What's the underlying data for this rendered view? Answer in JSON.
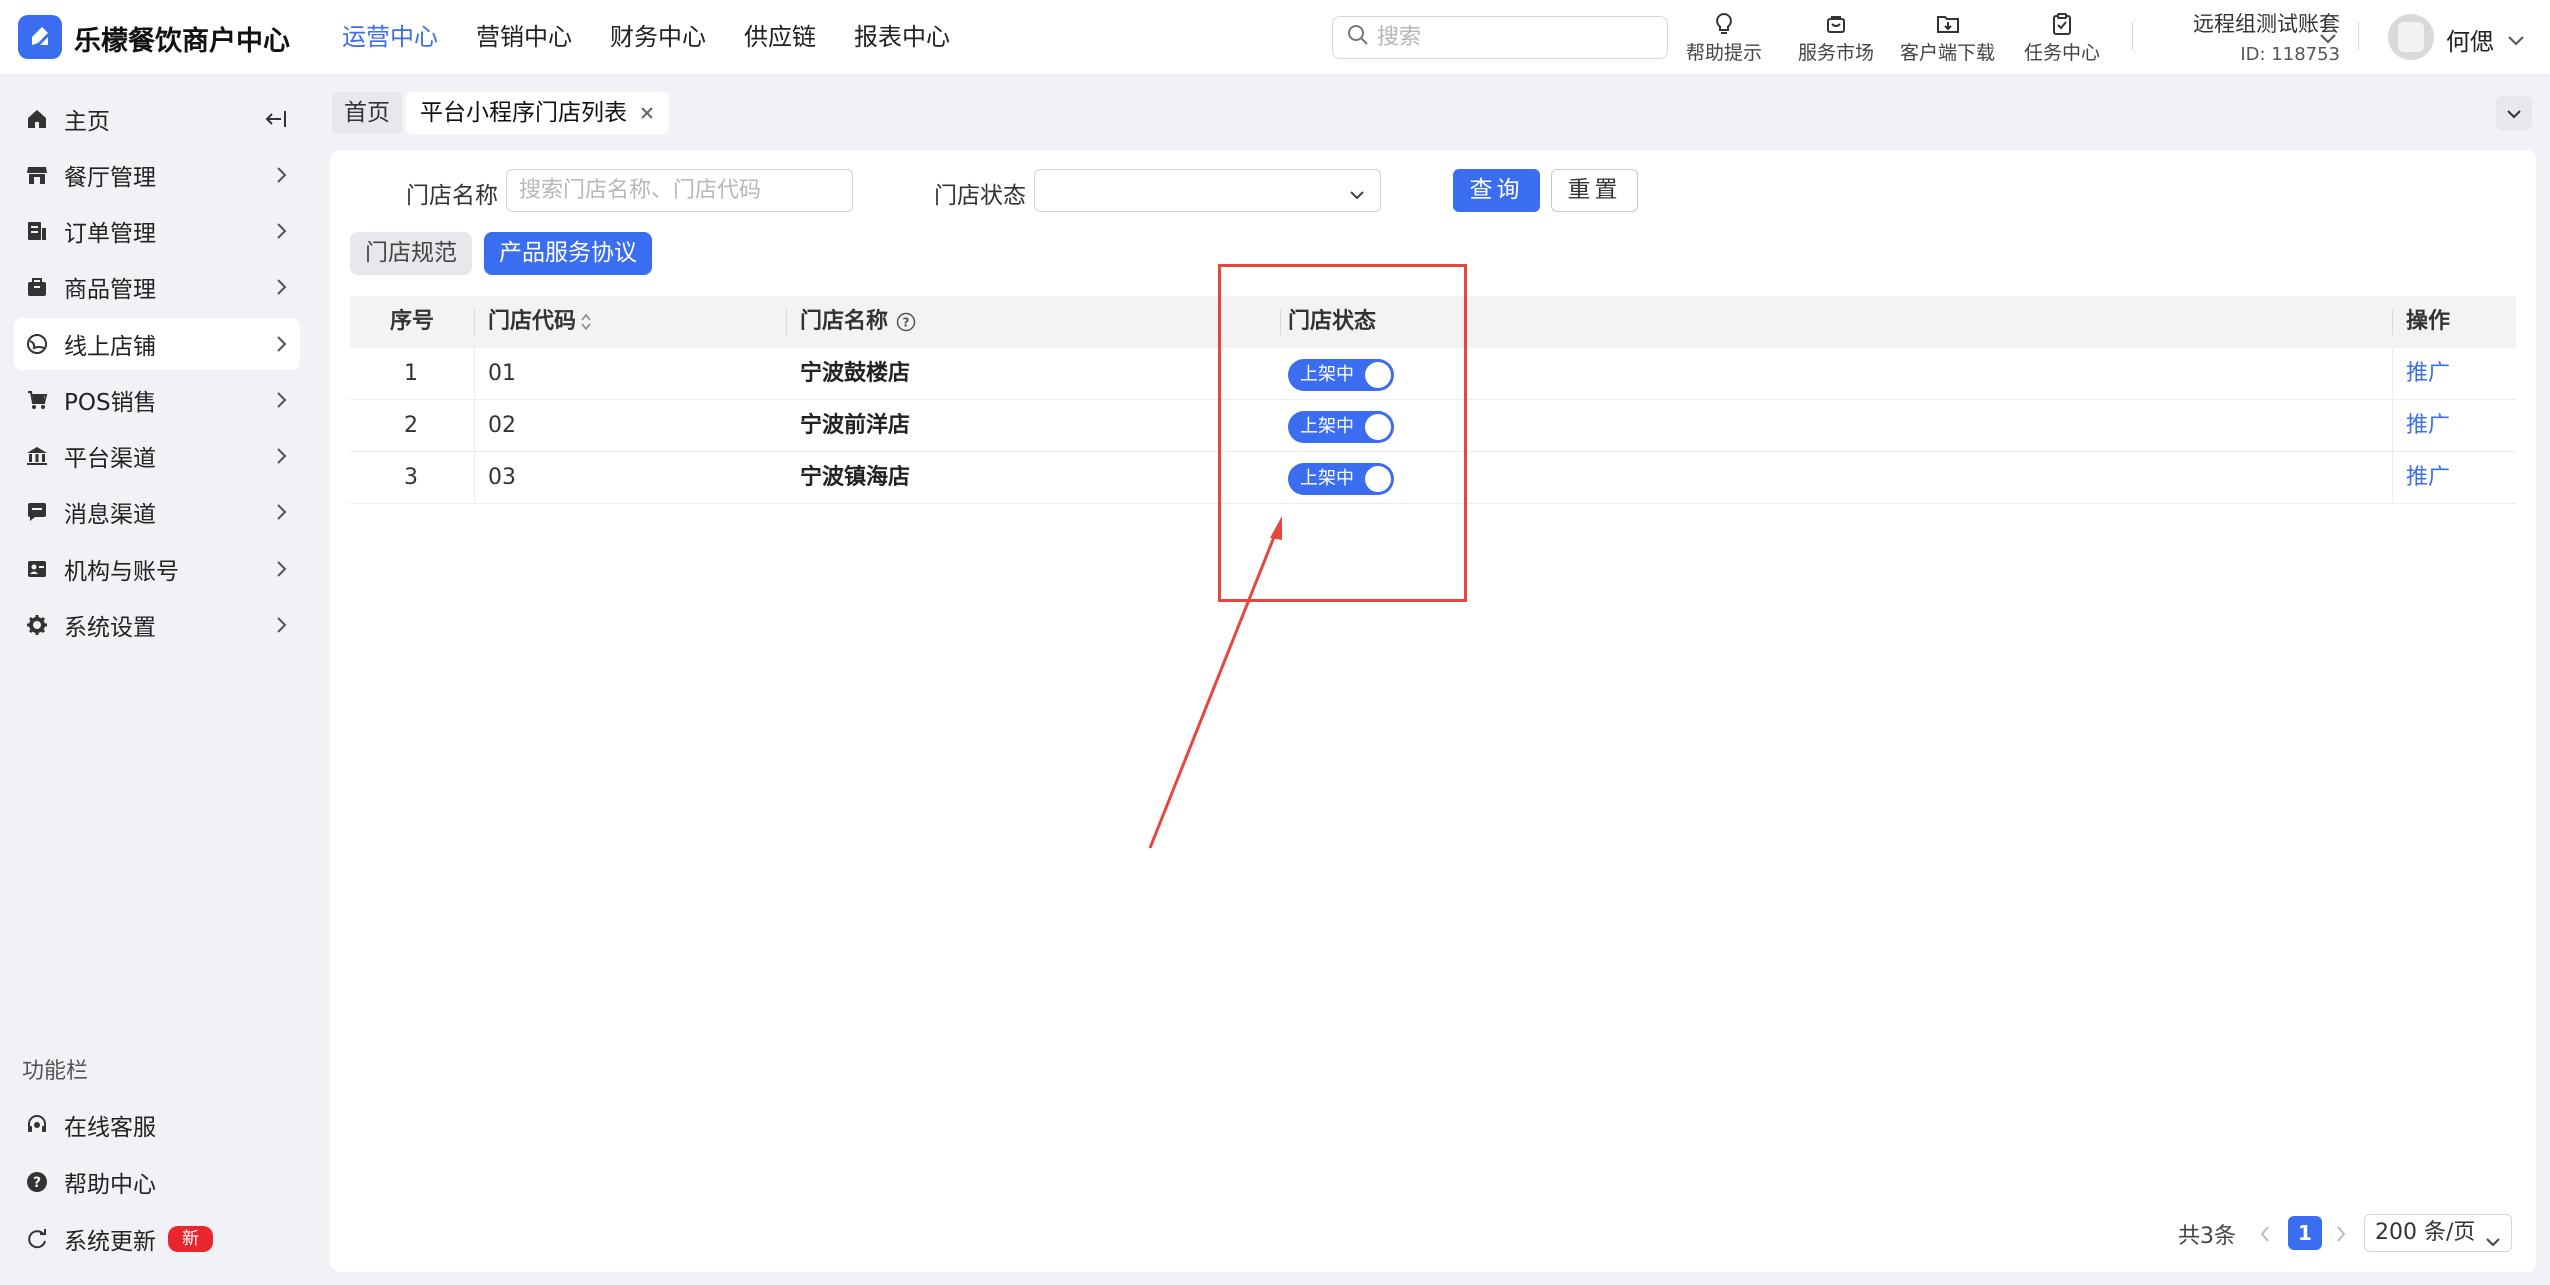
{
  "app": {
    "brand": "乐檬餐饮商户中心",
    "accent_color": "#3b6df0"
  },
  "topnav": {
    "items": [
      {
        "label": "运营中心",
        "active": true
      },
      {
        "label": "营销中心",
        "active": false
      },
      {
        "label": "财务中心",
        "active": false
      },
      {
        "label": "供应链",
        "active": false
      },
      {
        "label": "报表中心",
        "active": false
      }
    ]
  },
  "search": {
    "placeholder": "搜索",
    "icon": "search-icon"
  },
  "tools": [
    {
      "label": "帮助提示",
      "icon": "lightbulb-icon"
    },
    {
      "label": "服务市场",
      "icon": "shopping-bag-icon"
    },
    {
      "label": "客户端下载",
      "icon": "folder-download-icon"
    },
    {
      "label": "任务中心",
      "icon": "clipboard-check-icon"
    }
  ],
  "account": {
    "name": "远程组测试账套",
    "id": "ID: 118753"
  },
  "user": {
    "name": "何偲"
  },
  "sidebar": {
    "items": [
      {
        "label": "主页",
        "icon": "home-icon"
      },
      {
        "label": "餐厅管理",
        "icon": "store-icon"
      },
      {
        "label": "订单管理",
        "icon": "order-list-icon"
      },
      {
        "label": "商品管理",
        "icon": "goods-icon"
      },
      {
        "label": "线上店铺",
        "icon": "globe-icon",
        "active": true
      },
      {
        "label": "POS销售",
        "icon": "pos-cart-icon"
      },
      {
        "label": "平台渠道",
        "icon": "bank-icon"
      },
      {
        "label": "消息渠道",
        "icon": "message-icon"
      },
      {
        "label": "机构与账号",
        "icon": "id-card-icon"
      },
      {
        "label": "系统设置",
        "icon": "gear-icon"
      }
    ],
    "section_label": "功能栏",
    "bottom": [
      {
        "label": "在线客服",
        "icon": "headset-icon"
      },
      {
        "label": "帮助中心",
        "icon": "question-circle-icon"
      },
      {
        "label": "系统更新",
        "icon": "refresh-icon",
        "badge": "新"
      }
    ]
  },
  "tabs": {
    "home": "首页",
    "current": "平台小程序门店列表"
  },
  "filters": {
    "name_label": "门店名称",
    "name_placeholder": "搜索门店名称、门店代码",
    "status_label": "门店状态",
    "status_value": "",
    "query": "查询",
    "reset": "重置"
  },
  "segments": {
    "left": "门店规范",
    "right": "产品服务协议"
  },
  "table": {
    "headers": {
      "seq": "序号",
      "code": "门店代码",
      "name": "门店名称",
      "status": "门店状态",
      "action": "操作"
    },
    "rows": [
      {
        "seq": "1",
        "code": "01",
        "name": "宁波鼓楼店",
        "status": "上架中",
        "action": "推广"
      },
      {
        "seq": "2",
        "code": "02",
        "name": "宁波前洋店",
        "status": "上架中",
        "action": "推广"
      },
      {
        "seq": "3",
        "code": "03",
        "name": "宁波镇海店",
        "status": "上架中",
        "action": "推广"
      }
    ]
  },
  "pagination": {
    "total": "共3条",
    "page": "1",
    "page_size": "200 条/页"
  },
  "annotation": {
    "color": "#e8463b"
  }
}
